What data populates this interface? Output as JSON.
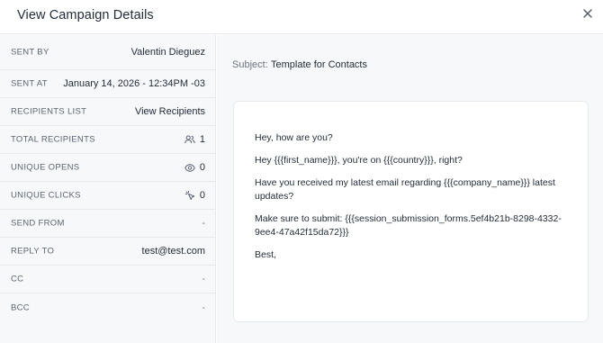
{
  "header": {
    "title": "View Campaign Details"
  },
  "details": [
    {
      "label": "SENT BY",
      "value": "Valentin Dieguez"
    },
    {
      "label": "SENT AT",
      "value": "January 14, 2026 - 12:34PM -03"
    },
    {
      "label": "RECIPIENTS LIST",
      "value": "View Recipients"
    },
    {
      "label": "TOTAL RECIPIENTS",
      "value": "1"
    },
    {
      "label": "UNIQUE OPENS",
      "value": "0"
    },
    {
      "label": "UNIQUE CLICKS",
      "value": "0"
    },
    {
      "label": "SEND FROM",
      "value": "-"
    },
    {
      "label": "REPLY TO",
      "value": "test@test.com"
    },
    {
      "label": "CC",
      "value": "-"
    },
    {
      "label": "BCC",
      "value": "-"
    }
  ],
  "subject": {
    "label": "Subject:",
    "value": "Template for Contacts"
  },
  "email": {
    "paragraphs": [
      "Hey, how are you?",
      "Hey {{{first_name}}}, you're on {{{country}}}, right?",
      "Have you received my latest email regarding {{{company_name}}} latest updates?",
      "Make sure to submit: {{{session_submission_forms.5ef4b21b-8298-4332-9ee4-47a42f15da72}}}",
      "Best,"
    ]
  },
  "icons": {
    "close": "close-icon",
    "recipients": "users-icon",
    "opens": "eye-icon",
    "clicks": "cursor-click-icon"
  }
}
